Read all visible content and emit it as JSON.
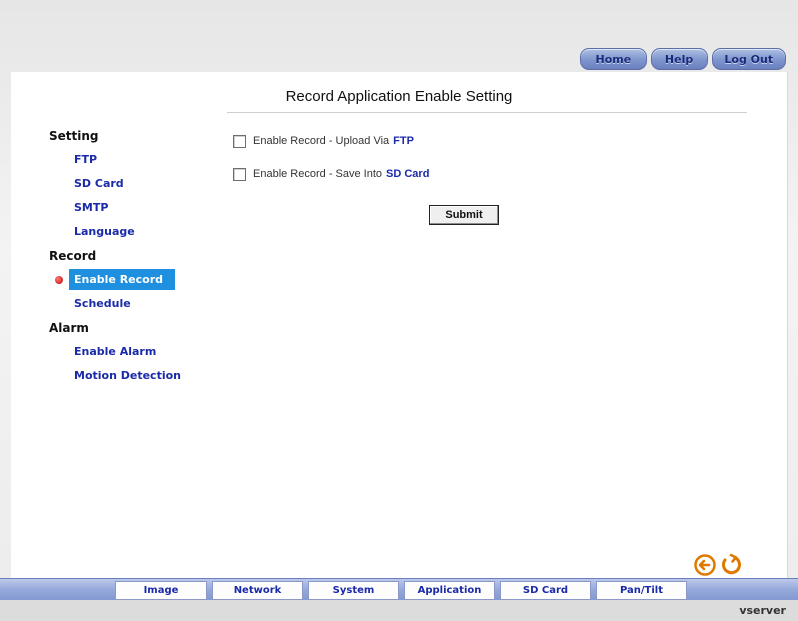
{
  "topnav": {
    "home_label": "Home",
    "help_label": "Help",
    "logout_label": "Log Out"
  },
  "page": {
    "title": "Record Application Enable Setting"
  },
  "sidebar": {
    "sections": [
      {
        "label": "Setting",
        "items": [
          "FTP",
          "SD Card",
          "SMTP",
          "Language"
        ]
      },
      {
        "label": "Record",
        "items": [
          "Enable Record",
          "Schedule"
        ]
      },
      {
        "label": "Alarm",
        "items": [
          "Enable Alarm",
          "Motion Detection"
        ]
      }
    ],
    "active_item": "Enable Record"
  },
  "form": {
    "option_ftp": {
      "text": "Enable Record - Upload Via",
      "highlight": "FTP",
      "checked": false
    },
    "option_sd": {
      "text": "Enable Record - Save Into",
      "highlight": "SD Card",
      "checked": false
    },
    "submit_label": "Submit"
  },
  "icons": [
    "back-arrow-icon",
    "refresh-icon"
  ],
  "tabs": [
    "Image",
    "Network",
    "System",
    "Application",
    "SD Card",
    "Pan/Tilt"
  ],
  "footer": {
    "brand": "vserver"
  },
  "colors": {
    "accent": "#1f8fe0",
    "link": "#1a2aa8",
    "tabbar": "#96a9db",
    "icon": "#e07800"
  }
}
